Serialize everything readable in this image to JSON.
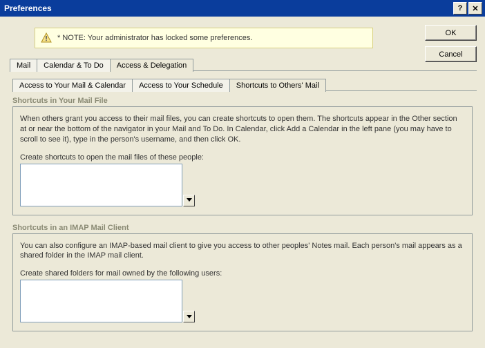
{
  "window": {
    "title": "Preferences"
  },
  "buttons": {
    "ok": "OK",
    "cancel": "Cancel"
  },
  "note": {
    "text": "* NOTE: Your administrator has locked some preferences."
  },
  "tabs": {
    "main": [
      {
        "label": "Mail"
      },
      {
        "label": "Calendar & To Do"
      },
      {
        "label": "Access & Delegation"
      }
    ],
    "sub": [
      {
        "label": "Access to Your Mail & Calendar"
      },
      {
        "label": "Access to Your Schedule"
      },
      {
        "label": "Shortcuts to Others' Mail"
      }
    ]
  },
  "section1": {
    "title": "Shortcuts in Your Mail File",
    "body": "When others grant you access to their mail files, you can create shortcuts to open them. The shortcuts appear in the Other section at or near the bottom of the navigator in your Mail and To Do. In Calendar, click Add a Calendar in the left pane (you may have to scroll to see it), type in the person's username, and then click OK.",
    "fieldLabel": "Create shortcuts to open the mail files of these people:",
    "value": ""
  },
  "section2": {
    "title": "Shortcuts in an IMAP Mail Client",
    "body": "You can also configure an IMAP-based mail client to give you access to other peoples' Notes mail. Each person's mail appears as a shared folder in the IMAP mail client.",
    "fieldLabel": "Create shared folders for mail owned by the following users:",
    "value": ""
  }
}
